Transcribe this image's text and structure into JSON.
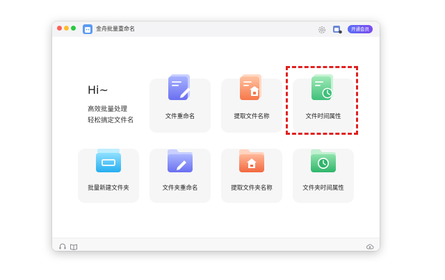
{
  "app": {
    "title": "金舟批量重命名"
  },
  "header": {
    "vip_label": "开通会员"
  },
  "welcome": {
    "greeting": "Hi~",
    "line1": "高效批量处理",
    "line2": "轻松搞定文件名"
  },
  "cards": [
    {
      "label": "文件重命名",
      "icon": "file-rename-icon"
    },
    {
      "label": "提取文件名称",
      "icon": "extract-filename-icon"
    },
    {
      "label": "文件时间属性",
      "icon": "file-time-icon"
    },
    {
      "label": "批量新建文件夹",
      "icon": "batch-new-folder-icon"
    },
    {
      "label": "文件夹重命名",
      "icon": "folder-rename-icon"
    },
    {
      "label": "提取文件夹名称",
      "icon": "extract-foldername-icon"
    },
    {
      "label": "文件夹时间属性",
      "icon": "folder-time-icon"
    }
  ],
  "colors": {
    "accent_purple": "#6a5cf4",
    "highlight_red": "#e02020",
    "card_bg": "#f6f6f7"
  }
}
